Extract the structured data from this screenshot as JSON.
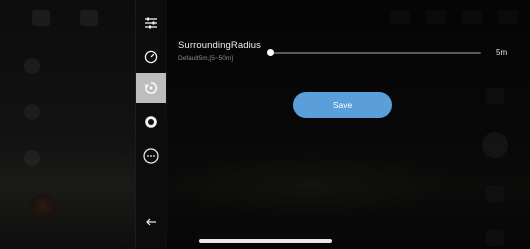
{
  "setting": {
    "title": "SurroundingRadius",
    "subtitle": "Default5m,[5~50m]",
    "value_label": "5m",
    "value": 5,
    "min": 5,
    "max": 50
  },
  "actions": {
    "save_label": "Save"
  },
  "menu": {
    "items": [
      {
        "icon": "sliders-icon",
        "active": false
      },
      {
        "icon": "speedometer-icon",
        "active": false
      },
      {
        "icon": "orbit-icon",
        "active": true
      },
      {
        "icon": "lens-ring-icon",
        "active": false
      },
      {
        "icon": "more-icon",
        "active": false
      },
      {
        "icon": "back-arrow-icon",
        "active": false
      }
    ]
  },
  "colors": {
    "accent": "#5a9fd9",
    "active_menu_bg": "#bdbdbd",
    "background": "#0c0c0c"
  }
}
